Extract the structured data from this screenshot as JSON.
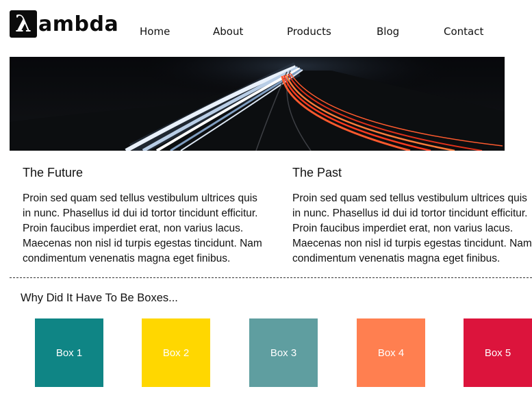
{
  "brand": {
    "mark": "λ",
    "name": "ambda"
  },
  "nav": {
    "items": [
      "Home",
      "About",
      "Products",
      "Blog",
      "Contact"
    ]
  },
  "articles": [
    {
      "title": "The Future",
      "lines": [
        "Proin sed quam sed tellus vestibulum ultrices quis",
        "in nunc. Phasellus id dui id tortor tincidunt efficitur.",
        "Proin faucibus imperdiet erat, non varius lacus.",
        "Maecenas non nisl id turpis egestas tincidunt. Nam",
        "condimentum venenatis magna eget finibus."
      ]
    },
    {
      "title": "The Past",
      "lines": [
        "Proin sed quam sed tellus vestibulum ultrices quis",
        "in nunc. Phasellus id dui id tortor tincidunt efficitur.",
        "Proin faucibus imperdiet erat, non varius lacus.",
        "Maecenas non nisl id turpis egestas tincidunt. Nam",
        "condimentum venenatis magna eget finibus."
      ]
    }
  ],
  "boxes_section": {
    "title": "Why Did It Have To Be Boxes...",
    "boxes": [
      {
        "label": "Box 1",
        "color": "#0f8585"
      },
      {
        "label": "Box 2",
        "color": "#ffd700"
      },
      {
        "label": "Box 3",
        "color": "#5f9ea0"
      },
      {
        "label": "Box 4",
        "color": "#ff7f50"
      },
      {
        "label": "Box 5",
        "color": "#dc143c"
      }
    ]
  }
}
